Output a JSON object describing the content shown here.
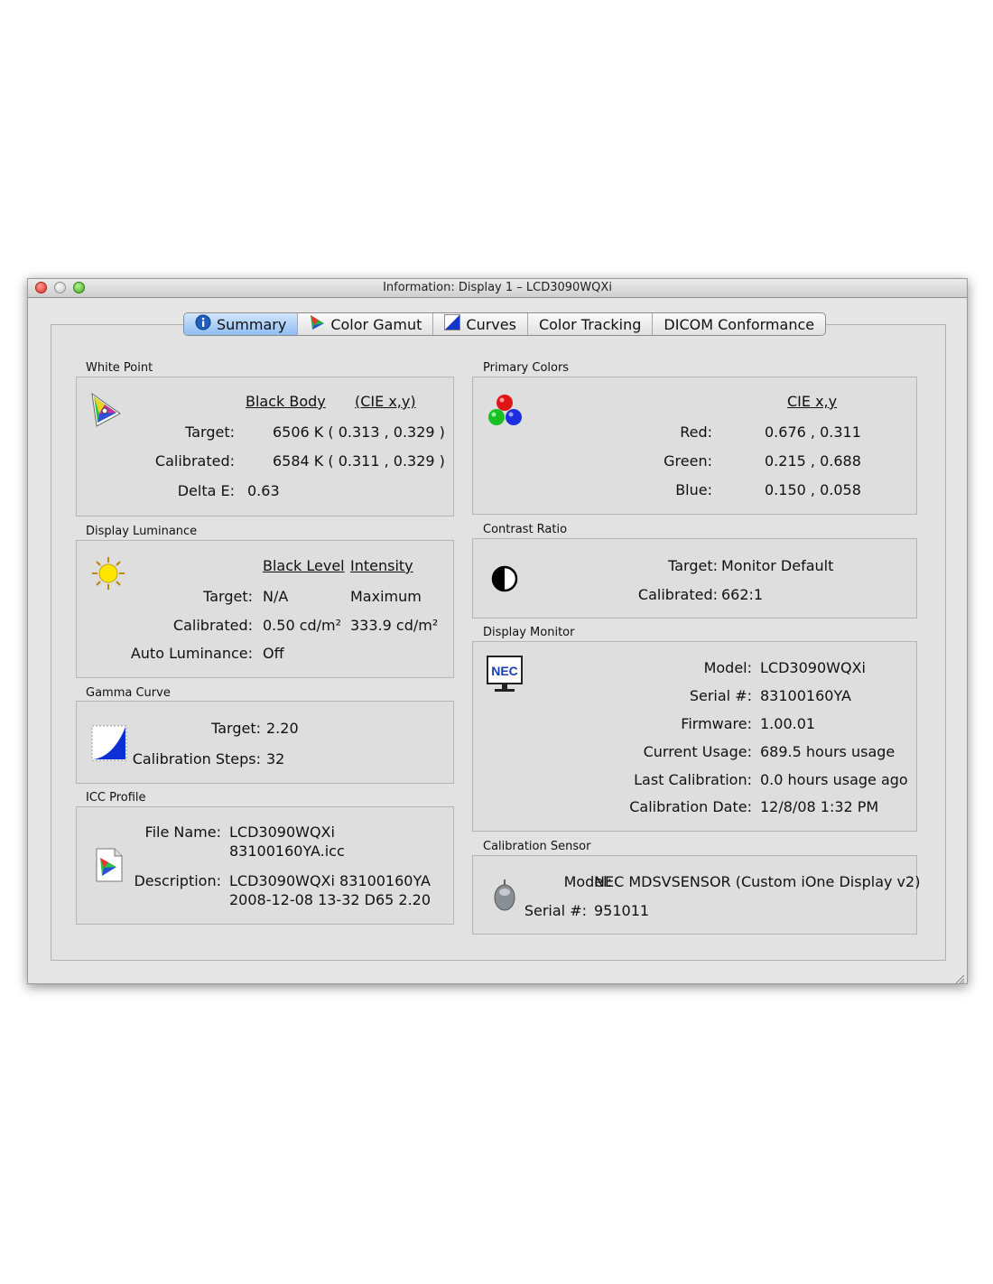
{
  "window": {
    "title": "Information: Display 1 – LCD3090WQXi"
  },
  "tabs": [
    {
      "label": "Summary",
      "icon": "info-icon",
      "active": true
    },
    {
      "label": "Color Gamut",
      "icon": "color-gamut-icon",
      "active": false
    },
    {
      "label": "Curves",
      "icon": "curves-icon",
      "active": false
    },
    {
      "label": "Color Tracking",
      "icon": "",
      "active": false
    },
    {
      "label": "DICOM Conformance",
      "icon": "",
      "active": false
    }
  ],
  "white_point": {
    "title": "White Point",
    "col1": "Black Body",
    "col2": "(CIE x,y)",
    "target_label": "Target:",
    "target_value": "6506 K  ( 0.313 , 0.329 )",
    "calibrated_label": "Calibrated:",
    "calibrated_value": "6584 K  ( 0.311 , 0.329 )",
    "delta_label": "Delta E:",
    "delta_value": "0.63"
  },
  "primary_colors": {
    "title": "Primary Colors",
    "col": "CIE x,y",
    "red_label": "Red:",
    "red_value": "0.676 , 0.311",
    "green_label": "Green:",
    "green_value": "0.215 , 0.688",
    "blue_label": "Blue:",
    "blue_value": "0.150 , 0.058"
  },
  "display_luminance": {
    "title": "Display Luminance",
    "col1": "Black Level",
    "col2": "Intensity",
    "target_label": "Target:",
    "target_black": "N/A",
    "target_intensity": "Maximum",
    "calibrated_label": "Calibrated:",
    "calibrated_black": "0.50 cd/m²",
    "calibrated_intensity": "333.9 cd/m²",
    "auto_label": "Auto Luminance:",
    "auto_value": "Off"
  },
  "contrast_ratio": {
    "title": "Contrast Ratio",
    "target_label": "Target:",
    "target_value": "Monitor Default",
    "calibrated_label": "Calibrated:",
    "calibrated_value": "662:1"
  },
  "gamma_curve": {
    "title": "Gamma Curve",
    "target_label": "Target:",
    "target_value": "2.20",
    "steps_label": "Calibration Steps:",
    "steps_value": "32"
  },
  "display_monitor": {
    "title": "Display Monitor",
    "logo_text": "NEC",
    "model_label": "Model:",
    "model_value": "LCD3090WQXi",
    "serial_label": "Serial #:",
    "serial_value": "83100160YA",
    "firmware_label": "Firmware:",
    "firmware_value": "1.00.01",
    "usage_label": "Current Usage:",
    "usage_value": "689.5 hours usage",
    "lastcal_label": "Last Calibration:",
    "lastcal_value": "0.0 hours usage ago",
    "caldate_label": "Calibration Date:",
    "caldate_value": "12/8/08 1:32 PM"
  },
  "icc_profile": {
    "title": "ICC Profile",
    "file_label": "File Name:",
    "file_line1": "LCD3090WQXi",
    "file_line2": "83100160YA.icc",
    "desc_label": "Description:",
    "desc_line1": "LCD3090WQXi 83100160YA",
    "desc_line2": "2008-12-08 13-32 D65 2.20"
  },
  "calibration_sensor": {
    "title": "Calibration Sensor",
    "model_label": "Model:",
    "model_value": "NEC MDSVSENSOR (Custom iOne Display v2)",
    "serial_label": "Serial #:",
    "serial_value": "951011"
  }
}
